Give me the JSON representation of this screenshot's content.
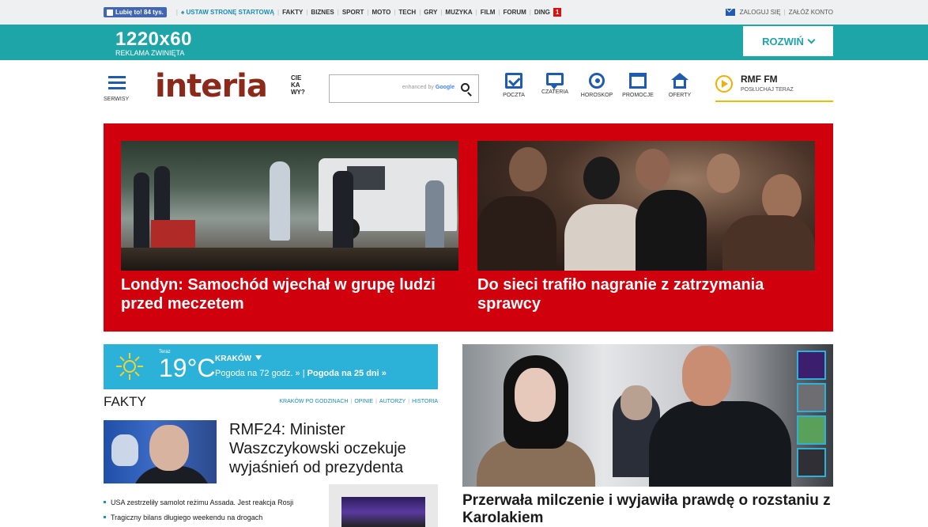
{
  "topbar": {
    "fb_like": "Lubię to! 84 tys.",
    "set_homepage": "USTAW STRONĘ STARTOWĄ",
    "nav": [
      "FAKTY",
      "BIZNES",
      "SPORT",
      "MOTO",
      "TECH",
      "GRY",
      "MUZYKA",
      "FILM",
      "FORUM",
      "DING"
    ],
    "ding_badge": "1",
    "login": "ZALOGUJ SIĘ",
    "register": "ZAŁÓŻ KONTO"
  },
  "ad": {
    "size": "1220x60",
    "caption": "REKLAMA ZWINIĘTA",
    "expand": "ROZWIŃ"
  },
  "header": {
    "menu_label": "SERWISY",
    "logo_text": "interia",
    "logo_tagline": "CIE KA WY?",
    "search_placeholder_prefix": "enhanced by",
    "search_placeholder_brand": "Google",
    "services": [
      "POCZTA",
      "CZATERIA",
      "HOROSKOP",
      "PROMOCJE",
      "OFERTY"
    ],
    "radio": {
      "name": "RMF FM",
      "action": "POSŁUCHAJ TERAZ"
    }
  },
  "hero": {
    "stories": [
      {
        "title": "Londyn: Samochód wjechał w grupę ludzi przed meczetem"
      },
      {
        "title": "Do sieci trafiło nagranie z zatrzymania sprawcy"
      }
    ]
  },
  "weather": {
    "now_label": "Teraz",
    "temperature": "19°C",
    "city": "KRAKÓW",
    "forecast_72": "Pogoda na 72 godz. »",
    "forecast_sep": " | ",
    "forecast_25": "Pogoda na 25 dni »"
  },
  "fakty": {
    "title": "FAKTY",
    "links": [
      "KRAKÓW PO GODZINACH",
      "OPINIE",
      "AUTORZY",
      "HISTORIA"
    ],
    "lead_title": "RMF24: Minister Waszczykowski oczekuje wyjaśnień od prezydenta",
    "items": [
      "USA zestrzeliły samolot reżimu Assada. Jest reakcja Rosji",
      "Tragiczny bilans długiego weekendu na drogach"
    ]
  },
  "feature": {
    "title": "Przerwała milczenie i wyjawiła prawdę o rozstaniu z Karolakiem",
    "thumb_colors": [
      "#3b1e6e",
      "#6e6e72",
      "#5aa05a",
      "#2f2f35"
    ]
  },
  "colors": {
    "accent_teal": "#1ea5a8",
    "hero_red": "#d0000c",
    "weather_blue": "#2cb2d8",
    "icon_blue": "#1f5bb0"
  }
}
